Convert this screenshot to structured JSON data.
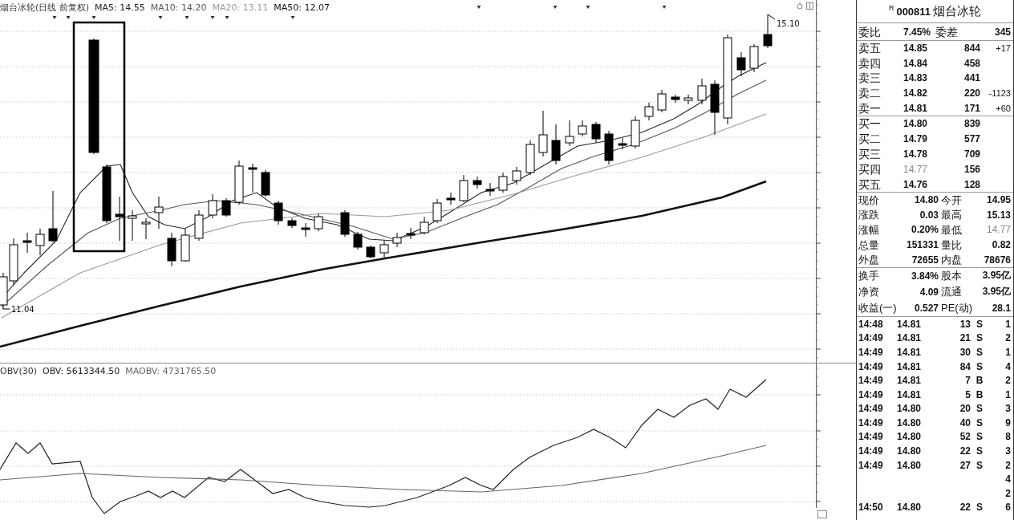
{
  "chart": {
    "title": "烟台冰轮(日线 前复权)",
    "moving_averages": [
      {
        "text": "MA5: 14.55",
        "color": "#222222"
      },
      {
        "text": "MA10: 14.20",
        "color": "#555555"
      },
      {
        "text": "MA20: 13.11",
        "color": "#999999"
      },
      {
        "text": "MA50: 12.07",
        "color": "#111111"
      }
    ],
    "high_label": "15.10",
    "low_label": "11.04"
  },
  "indicator": {
    "title": "OBV(30)",
    "series": [
      {
        "text": "OBV: 5613344.50",
        "color": "#222222"
      },
      {
        "text": "MAOBV: 4731765.50",
        "color": "#666666"
      }
    ]
  },
  "quote": {
    "mark": "R",
    "code": "000811",
    "name": "烟台冰轮",
    "summary": {
      "label": "委比",
      "value": "7.45%",
      "label_2": "委差",
      "value_2": "345"
    },
    "asks": [
      {
        "label": "卖五",
        "price": "14.85",
        "volume": "844",
        "change": "+17"
      },
      {
        "label": "卖四",
        "price": "14.84",
        "volume": "458"
      },
      {
        "label": "卖三",
        "price": "14.83",
        "volume": "441"
      },
      {
        "label": "卖二",
        "price": "14.82",
        "volume": "220",
        "change": "-1123"
      },
      {
        "label": "卖一",
        "price": "14.81",
        "volume": "171",
        "change": "+60"
      }
    ],
    "bids": [
      {
        "label": "买一",
        "price": "14.80",
        "volume": "839",
        "dim": false
      },
      {
        "label": "买二",
        "price": "14.79",
        "volume": "577",
        "dim": false
      },
      {
        "label": "买三",
        "price": "14.78",
        "volume": "709",
        "dim": false
      },
      {
        "label": "买四",
        "price": "14.77",
        "volume": "156",
        "dim": true
      },
      {
        "label": "买五",
        "price": "14.76",
        "volume": "128",
        "dim": false
      }
    ],
    "stat_groups": [
      [
        {
          "label": "现价",
          "value": "14.80",
          "dim": false
        },
        {
          "label": "今开",
          "value": "14.95",
          "dim": false
        },
        {
          "label": "涨跌",
          "value": "0.03",
          "dim": false
        },
        {
          "label": "最高",
          "value": "15.13",
          "dim": false
        },
        {
          "label": "涨幅",
          "value": "0.20%",
          "dim": false
        },
        {
          "label": "最低",
          "value": "14.77",
          "dim": true
        },
        {
          "label": "总量",
          "value": "151331",
          "dim": false
        },
        {
          "label": "量比",
          "value": "0.82",
          "dim": false
        },
        {
          "label": "外盘",
          "value": "72655",
          "dim": false
        },
        {
          "label": "内盘",
          "value": "78676",
          "dim": false
        }
      ],
      [
        {
          "label": "换手",
          "value": "3.84%",
          "dim": false
        },
        {
          "label": "股本",
          "value": "3.95亿",
          "dim": false
        },
        {
          "label": "净资",
          "value": "4.09",
          "dim": false
        },
        {
          "label": "流通",
          "value": "3.95亿",
          "dim": false
        },
        {
          "label": "收益(一)",
          "value": "0.527",
          "dim": false
        },
        {
          "label": "PE(动)",
          "value": "28.1",
          "dim": false
        }
      ]
    ],
    "ticks": [
      {
        "time": "14:48",
        "price": "14.81",
        "volume": "13",
        "side": "S",
        "count": "1"
      },
      {
        "time": "14:49",
        "price": "14.81",
        "volume": "21",
        "side": "S",
        "count": "2"
      },
      {
        "time": "14:49",
        "price": "14.81",
        "volume": "30",
        "side": "S",
        "count": "1"
      },
      {
        "time": "14:49",
        "price": "14.81",
        "volume": "84",
        "side": "S",
        "count": "4"
      },
      {
        "time": "14:49",
        "price": "14.81",
        "volume": "7",
        "side": "B",
        "count": "2"
      },
      {
        "time": "14:49",
        "price": "14.81",
        "volume": "5",
        "side": "B",
        "count": "1"
      },
      {
        "time": "14:49",
        "price": "14.80",
        "volume": "20",
        "side": "S",
        "count": "3"
      },
      {
        "time": "14:49",
        "price": "14.80",
        "volume": "40",
        "side": "S",
        "count": "9"
      },
      {
        "time": "14:49",
        "price": "14.80",
        "volume": "52",
        "side": "S",
        "count": "8"
      },
      {
        "time": "14:49",
        "price": "14.80",
        "volume": "22",
        "side": "S",
        "count": "3"
      },
      {
        "time": "14:49",
        "price": "14.80",
        "volume": "27",
        "side": "S",
        "count": "2"
      },
      {
        "count": "4"
      },
      {
        "count": "2"
      },
      {
        "time": "14:50",
        "price": "14.80",
        "volume": "22",
        "side": "S",
        "count": "6"
      }
    ]
  }
}
